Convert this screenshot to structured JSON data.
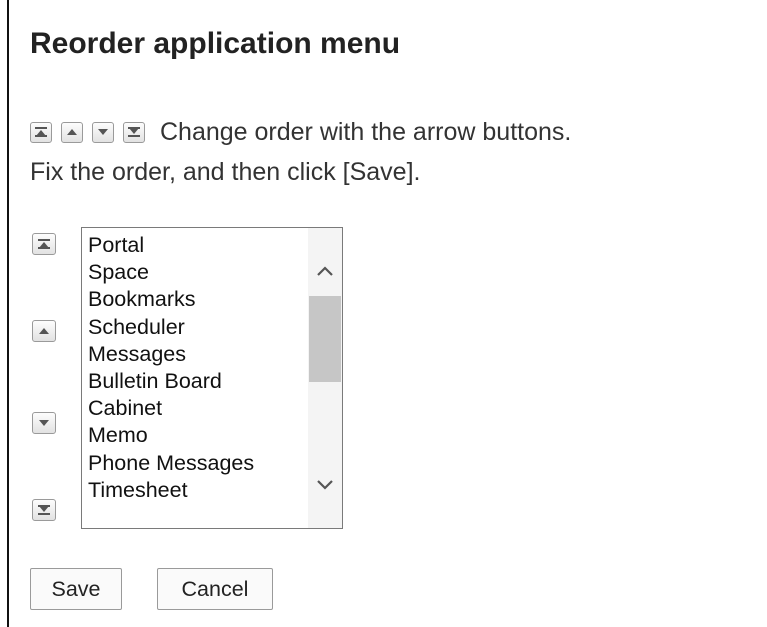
{
  "title": "Reorder application menu",
  "instructions": {
    "line1": "Change order with the arrow buttons.",
    "line2": "Fix the order, and then click [Save]."
  },
  "icons": {
    "move_top": "move-to-top-icon",
    "move_up": "move-up-icon",
    "move_down": "move-down-icon",
    "move_bottom": "move-to-bottom-icon"
  },
  "menu_items": [
    "Portal",
    "Space",
    "Bookmarks",
    "Scheduler",
    "Messages",
    "Bulletin Board",
    "Cabinet",
    "Memo",
    "Phone Messages",
    "Timesheet"
  ],
  "buttons": {
    "save": "Save",
    "cancel": "Cancel"
  }
}
